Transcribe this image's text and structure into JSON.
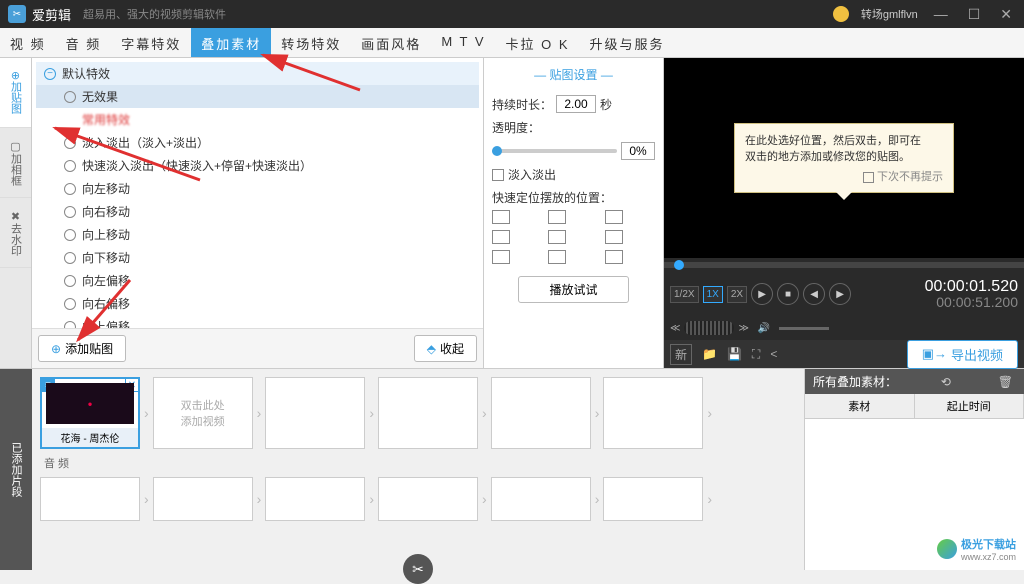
{
  "titlebar": {
    "app_name": "爱剪辑",
    "subtitle": "超易用、强大的视频剪辑软件",
    "user": "转场gmlflvn"
  },
  "tabs": [
    "视  频",
    "音  频",
    "字幕特效",
    "叠加素材",
    "转场特效",
    "画面风格",
    "M  T  V",
    "卡拉 O K",
    "升级与服务"
  ],
  "active_tab": 3,
  "sidebar": [
    {
      "label": "加贴图",
      "active": true
    },
    {
      "label": "加相框",
      "active": false
    },
    {
      "label": "去水印",
      "active": false
    }
  ],
  "effects": {
    "header": "默认特效",
    "items": [
      "无效果",
      "淡入淡出（淡入+淡出）",
      "快速淡入淡出（快速淡入+停留+快速淡出）",
      "向左移动",
      "向右移动",
      "向上移动",
      "向下移动",
      "向左偏移",
      "向右偏移",
      "向上偏移"
    ],
    "selected": 0,
    "hidden_item": "常用特效"
  },
  "center_buttons": {
    "add": "添加贴图",
    "collapse": "收起"
  },
  "settings": {
    "title": "贴图设置",
    "duration_label": "持续时长：",
    "duration_value": "2.00",
    "duration_unit": "秒",
    "opacity_label": "透明度：",
    "opacity_value": "0%",
    "fade_label": "淡入淡出",
    "quickpos_label": "快速定位摆放的位置：",
    "play_test": "播放试试"
  },
  "preview": {
    "tooltip_line1": "在此处选好位置，然后双击，即可在",
    "tooltip_line2": "双击的地方添加或修改您的贴图。",
    "tooltip_checkbox": "下次不再提示",
    "speeds": [
      "1/2X",
      "1X",
      "2X"
    ],
    "speed_active": 1,
    "time_current": "00:00:01.520",
    "time_total": "00:00:51.200",
    "export": "导出视频",
    "toolbar_new": "新"
  },
  "timeline": {
    "side_label": "已添加片段",
    "clip1_label": "花海 - 周杰伦",
    "empty_hint": "双击此处\n添加视频",
    "audio_label": "音 频"
  },
  "materials": {
    "header": "所有叠加素材：",
    "col1": "素材",
    "col2": "起止时间"
  },
  "watermark": {
    "name": "极光下载站",
    "url": "www.xz7.com"
  }
}
